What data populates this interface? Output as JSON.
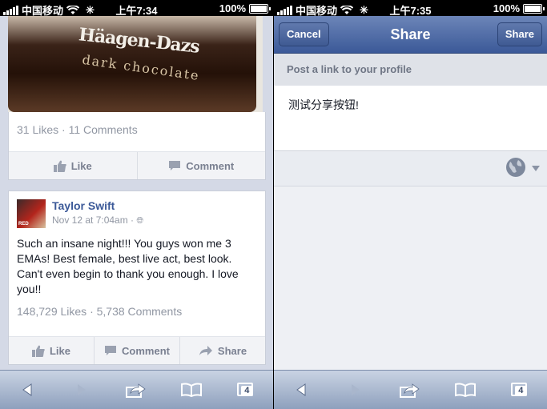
{
  "left": {
    "status": {
      "carrier": "中国移动",
      "time": "上午7:34",
      "battery": "100%"
    },
    "photo": {
      "brand_text": "Häagen-Dazs",
      "flavor_text": "dark chocolate"
    },
    "post1": {
      "stats": "31 Likes · 11 Comments",
      "like_label": "Like",
      "comment_label": "Comment"
    },
    "post2": {
      "author": "Taylor Swift",
      "meta": "Nov 12 at 7:04am ·",
      "text": "Such an insane night!!! You guys won me 3 EMAs! Best female, best live act, best look. Can't even begin to thank you enough. I love you!!",
      "stats": "148,729 Likes · 5,738 Comments",
      "like_label": "Like",
      "comment_label": "Comment",
      "share_label": "Share"
    },
    "toolbar": {
      "tabs_count": "4"
    }
  },
  "right": {
    "status": {
      "carrier": "中国移动",
      "time": "上午7:35",
      "battery": "100%"
    },
    "nav": {
      "cancel_label": "Cancel",
      "title": "Share",
      "share_label": "Share"
    },
    "post_link_label": "Post a link to your profile",
    "message": "测试分享按钮!",
    "toolbar": {
      "tabs_count": "4"
    }
  },
  "icons": [
    "signal-bars-icon",
    "wifi-icon",
    "activity-spinner-icon",
    "battery-icon",
    "thumbs-up-icon",
    "comment-bubble-icon",
    "share-arrow-icon",
    "globe-icon",
    "back-arrow-icon",
    "forward-arrow-icon",
    "action-share-icon",
    "bookmarks-icon",
    "tabs-icon"
  ],
  "colors": {
    "facebook_blue": "#3b5998",
    "link_name": "#3b5998",
    "meta_gray": "#9197a3"
  }
}
